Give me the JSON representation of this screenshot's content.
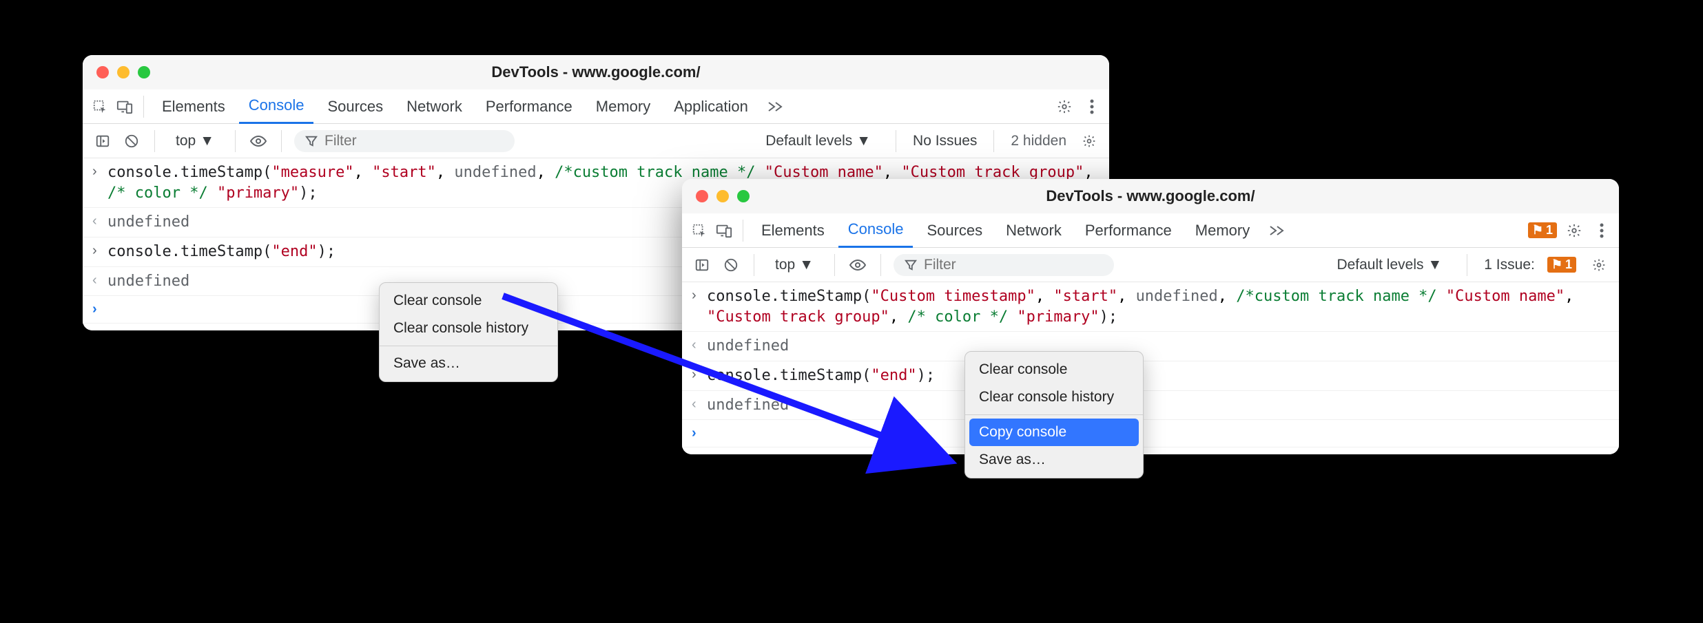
{
  "window1": {
    "title": "DevTools - www.google.com/",
    "tabs": [
      "Elements",
      "Console",
      "Sources",
      "Network",
      "Performance",
      "Memory",
      "Application"
    ],
    "activeTab": "Console",
    "subbar": {
      "context": "top",
      "filterPlaceholder": "Filter",
      "levels": "Default levels",
      "issues": "No Issues",
      "hidden": "2 hidden"
    },
    "console": {
      "line1": {
        "pre": "console.timeStamp(",
        "s1": "\"measure\"",
        "c1": ", ",
        "s2": "\"start\"",
        "c2": ", ",
        "u1": "undefined",
        "c3": ", ",
        "cm1": "/*custom track name */ ",
        "s3": "\"Custom name\"",
        "c4": ", ",
        "s4": "\"Custom track group\"",
        "c5": ", ",
        "cm2": "/* color */ ",
        "s5": "\"primary\"",
        "post": ");"
      },
      "undef": "undefined",
      "line2": {
        "pre": "console.timeStamp(",
        "s1": "\"end\"",
        "post": ");"
      }
    },
    "menu": {
      "clear": "Clear console",
      "clearHistory": "Clear console history",
      "saveAs": "Save as…"
    }
  },
  "window2": {
    "title": "DevTools - www.google.com/",
    "tabs": [
      "Elements",
      "Console",
      "Sources",
      "Network",
      "Performance",
      "Memory"
    ],
    "activeTab": "Console",
    "tabIssueCount": "1",
    "subbar": {
      "context": "top",
      "filterPlaceholder": "Filter",
      "levels": "Default levels",
      "issuesLabel": "1 Issue:",
      "issuesCount": "1"
    },
    "console": {
      "line1": {
        "pre": "console.timeStamp(",
        "s1": "\"Custom timestamp\"",
        "c1": ", ",
        "s2": "\"start\"",
        "c2": ", ",
        "u1": "undefined",
        "c3": ", ",
        "cm1": "/*custom track name */ ",
        "s3": "\"Custom name\"",
        "c4": ", ",
        "s4": "\"Custom track group\"",
        "c5": ", ",
        "cm2": "/* color */ ",
        "s5": "\"primary\"",
        "post": ");"
      },
      "undef": "undefined",
      "line2": {
        "pre": "console.timeStamp(",
        "s1": "\"end\"",
        "post": ");"
      }
    },
    "menu": {
      "clear": "Clear console",
      "clearHistory": "Clear console history",
      "copy": "Copy console",
      "saveAs": "Save as…"
    }
  }
}
